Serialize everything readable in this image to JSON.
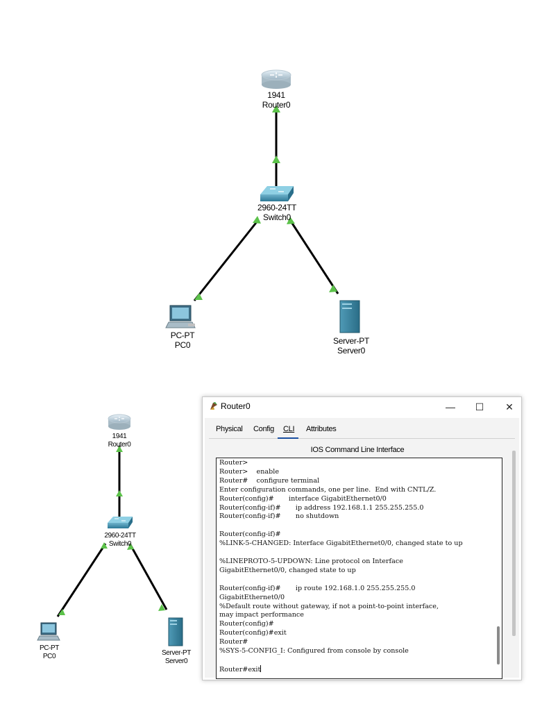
{
  "topology_top": {
    "router": {
      "model": "1941",
      "name": "Router0"
    },
    "switch": {
      "model": "2960-24TT",
      "name": "Switch0"
    },
    "pc": {
      "model": "PC-PT",
      "name": "PC0"
    },
    "server": {
      "model": "Server-PT",
      "name": "Server0"
    }
  },
  "topology_bottom": {
    "router": {
      "model": "1941",
      "name": "Router0"
    },
    "switch": {
      "model": "2960-24TT",
      "name": "Switch0"
    },
    "pc": {
      "model": "PC-PT",
      "name": "PC0"
    },
    "server": {
      "model": "Server-PT",
      "name": "Server0"
    }
  },
  "link_color": "#000000",
  "link_status_color": "#5cc24a",
  "window": {
    "title": "Router0",
    "minimize": "—",
    "maximize": "☐",
    "close": "✕",
    "tabs": [
      {
        "label": "Physical",
        "active": false
      },
      {
        "label": "Config",
        "active": false
      },
      {
        "label": "CLI",
        "active": true
      },
      {
        "label": "Attributes",
        "active": false
      }
    ],
    "cli_heading": "IOS Command Line Interface",
    "cli_output": "Router>\nRouter>    enable\nRouter#    configure terminal\nEnter configuration commands, one per line.  End with CNTL/Z.\nRouter(config)#       interface GigabitEthernet0/0\nRouter(config-if)#       ip address 192.168.1.1 255.255.255.0\nRouter(config-if)#       no shutdown\n\nRouter(config-if)#\n%LINK-5-CHANGED: Interface GigabitEthernet0/0, changed state to up\n\n%LINEPROTO-5-UPDOWN: Line protocol on Interface\nGigabitEthernet0/0, changed state to up\n\nRouter(config-if)#       ip route 192.168.1.0 255.255.255.0\nGigabitEthernet0/0\n%Default route without gateway, if not a point-to-point interface,\nmay impact performance\nRouter(config)#\nRouter(config)#exit\nRouter#\n%SYS-5-CONFIG_I: Configured from console by console\n\n",
    "cli_prompt": "Router#exit"
  }
}
